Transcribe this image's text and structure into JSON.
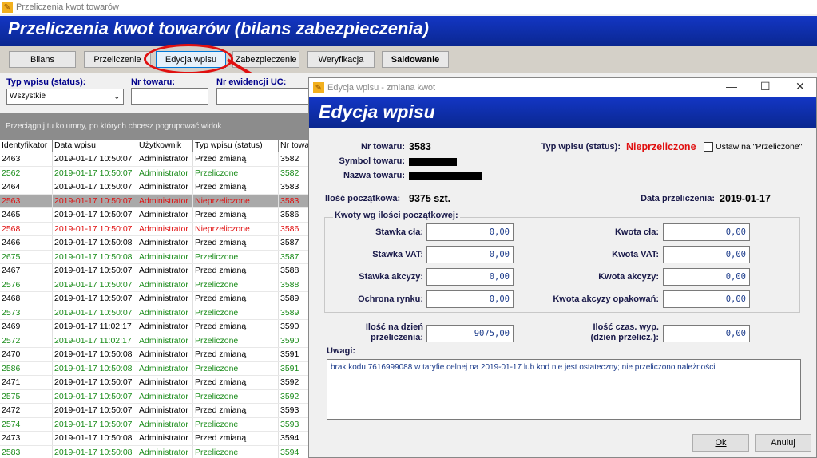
{
  "window_title": "Przeliczenia kwot towarów",
  "banner_title": "Przeliczenia kwot towarów (bilans zabezpieczenia)",
  "toolbar": [
    "Bilans",
    "Przeliczenie",
    "Edycja wpisu",
    "Zabezpieczenie",
    "Weryfikacja",
    "Saldowanie"
  ],
  "filters": {
    "status_label": "Typ wpisu (status):",
    "status_value": "Wszystkie",
    "nr_towaru_label": "Nr towaru:",
    "nr_ewidencji_label": "Nr ewidencji UC:"
  },
  "group_hint": "Przeciągnij tu kolumny, po których chcesz pogrupować widok",
  "grid": {
    "columns": [
      "Identyfikator",
      "Data wpisu",
      "Użytkownik",
      "Typ wpisu (status)",
      "Nr towa"
    ],
    "rows": [
      {
        "id": "2463",
        "date": "2019-01-17 10:50:07",
        "user": "Administrator",
        "type": "Przed zmianą",
        "nr": "3582",
        "style": "black"
      },
      {
        "id": "2562",
        "date": "2019-01-17 10:50:07",
        "user": "Administrator",
        "type": "Przeliczone",
        "nr": "3582",
        "style": "green"
      },
      {
        "id": "2464",
        "date": "2019-01-17 10:50:07",
        "user": "Administrator",
        "type": "Przed zmianą",
        "nr": "3583",
        "style": "black"
      },
      {
        "id": "2563",
        "date": "2019-01-17 10:50:07",
        "user": "Administrator",
        "type": "Nieprzeliczone",
        "nr": "3583",
        "style": "red sel"
      },
      {
        "id": "2465",
        "date": "2019-01-17 10:50:07",
        "user": "Administrator",
        "type": "Przed zmianą",
        "nr": "3586",
        "style": "black"
      },
      {
        "id": "2568",
        "date": "2019-01-17 10:50:07",
        "user": "Administrator",
        "type": "Nieprzeliczone",
        "nr": "3586",
        "style": "red"
      },
      {
        "id": "2466",
        "date": "2019-01-17 10:50:08",
        "user": "Administrator",
        "type": "Przed zmianą",
        "nr": "3587",
        "style": "black"
      },
      {
        "id": "2675",
        "date": "2019-01-17 10:50:08",
        "user": "Administrator",
        "type": "Przeliczone",
        "nr": "3587",
        "style": "green"
      },
      {
        "id": "2467",
        "date": "2019-01-17 10:50:07",
        "user": "Administrator",
        "type": "Przed zmianą",
        "nr": "3588",
        "style": "black"
      },
      {
        "id": "2576",
        "date": "2019-01-17 10:50:07",
        "user": "Administrator",
        "type": "Przeliczone",
        "nr": "3588",
        "style": "green"
      },
      {
        "id": "2468",
        "date": "2019-01-17 10:50:07",
        "user": "Administrator",
        "type": "Przed zmianą",
        "nr": "3589",
        "style": "black"
      },
      {
        "id": "2573",
        "date": "2019-01-17 10:50:07",
        "user": "Administrator",
        "type": "Przeliczone",
        "nr": "3589",
        "style": "green"
      },
      {
        "id": "2469",
        "date": "2019-01-17 11:02:17",
        "user": "Administrator",
        "type": "Przed zmianą",
        "nr": "3590",
        "style": "black"
      },
      {
        "id": "2572",
        "date": "2019-01-17 11:02:17",
        "user": "Administrator",
        "type": "Przeliczone",
        "nr": "3590",
        "style": "green"
      },
      {
        "id": "2470",
        "date": "2019-01-17 10:50:08",
        "user": "Administrator",
        "type": "Przed zmianą",
        "nr": "3591",
        "style": "black"
      },
      {
        "id": "2586",
        "date": "2019-01-17 10:50:08",
        "user": "Administrator",
        "type": "Przeliczone",
        "nr": "3591",
        "style": "green"
      },
      {
        "id": "2471",
        "date": "2019-01-17 10:50:07",
        "user": "Administrator",
        "type": "Przed zmianą",
        "nr": "3592",
        "style": "black"
      },
      {
        "id": "2575",
        "date": "2019-01-17 10:50:07",
        "user": "Administrator",
        "type": "Przeliczone",
        "nr": "3592",
        "style": "green"
      },
      {
        "id": "2472",
        "date": "2019-01-17 10:50:07",
        "user": "Administrator",
        "type": "Przed zmianą",
        "nr": "3593",
        "style": "black"
      },
      {
        "id": "2574",
        "date": "2019-01-17 10:50:07",
        "user": "Administrator",
        "type": "Przeliczone",
        "nr": "3593",
        "style": "green"
      },
      {
        "id": "2473",
        "date": "2019-01-17 10:50:08",
        "user": "Administrator",
        "type": "Przed zmianą",
        "nr": "3594",
        "style": "black"
      },
      {
        "id": "2583",
        "date": "2019-01-17 10:50:08",
        "user": "Administrator",
        "type": "Przeliczone",
        "nr": "3594",
        "style": "green"
      }
    ]
  },
  "dialog": {
    "title": "Edycja wpisu - zmiana kwot",
    "banner": "Edycja wpisu",
    "nr_towaru_label": "Nr towaru:",
    "nr_towaru": "3583",
    "symbol_label": "Symbol towaru:",
    "nazwa_label": "Nazwa towaru:",
    "typ_label": "Typ wpisu (status):",
    "typ_value": "Nieprzeliczone",
    "ustaw_label": "Ustaw na \"Przeliczone\"",
    "ilosc_label": "Ilość początkowa:",
    "ilosc_value": "9375 szt.",
    "data_label": "Data przeliczenia:",
    "data_value": "2019-01-17",
    "kwoty_group": "Kwoty wg ilości początkowej:",
    "fields_left": [
      {
        "label": "Stawka cła:",
        "value": "0,00"
      },
      {
        "label": "Stawka VAT:",
        "value": "0,00"
      },
      {
        "label": "Stawka akcyzy:",
        "value": "0,00"
      },
      {
        "label": "Ochrona rynku:",
        "value": "0,00"
      }
    ],
    "fields_right": [
      {
        "label": "Kwota cła:",
        "value": "0,00"
      },
      {
        "label": "Kwota VAT:",
        "value": "0,00"
      },
      {
        "label": "Kwota akcyzy:",
        "value": "0,00"
      },
      {
        "label": "Kwota akcyzy opakowań:",
        "value": "0,00"
      }
    ],
    "ilosc_dzien_label1": "Ilość na dzień",
    "ilosc_dzien_label2": "przeliczenia:",
    "ilosc_dzien_value": "9075,00",
    "ilosc_czas_label1": "Ilość czas. wyp.",
    "ilosc_czas_label2": "(dzień przelicz.):",
    "ilosc_czas_value": "0,00",
    "uwagi_label": "Uwagi:",
    "uwagi": "brak kodu 7616999088 w taryfie celnej na 2019-01-17 lub kod nie jest ostateczny; nie przeliczono należności",
    "ok": "Ok",
    "anuluj": "Anuluj"
  }
}
